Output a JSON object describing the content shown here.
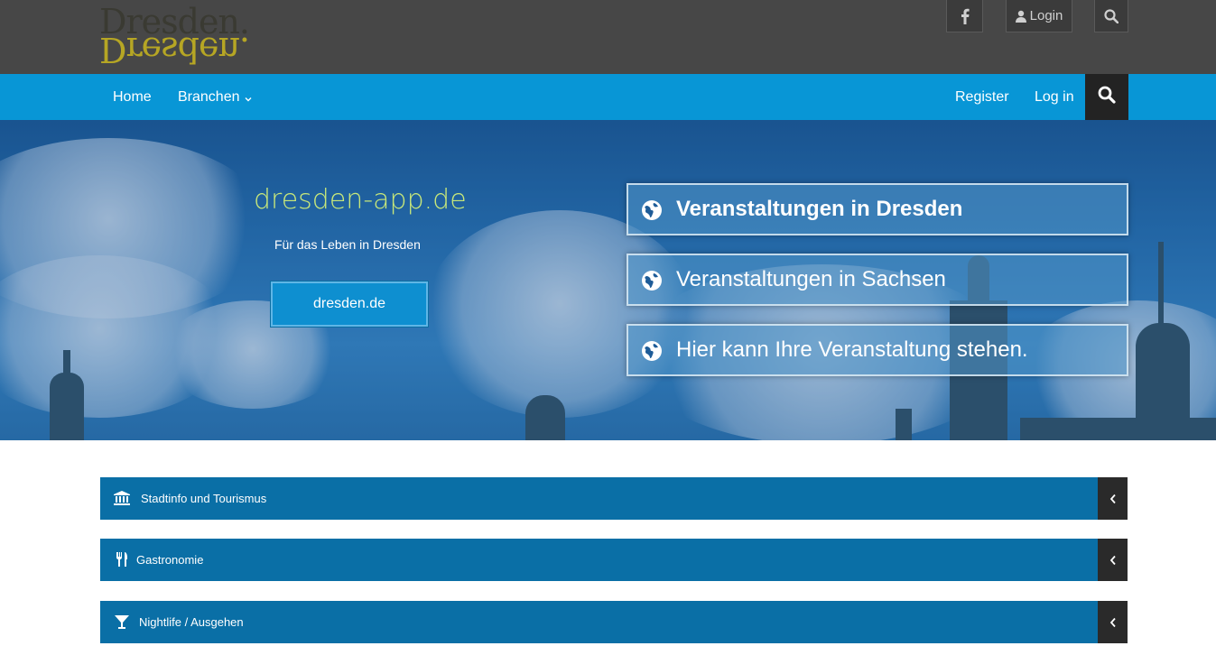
{
  "header": {
    "logo_text": "Dresden.",
    "login_label": "Login",
    "icons": [
      "facebook-icon",
      "user-icon",
      "search-icon"
    ]
  },
  "nav": {
    "home": "Home",
    "branchen": "Branchen",
    "register": "Register",
    "login": "Log in"
  },
  "hero": {
    "title": "dresden-app.de",
    "subtitle": "Für das Leben in Dresden",
    "button": "dresden.de",
    "events": [
      {
        "label": "Veranstaltungen in Dresden",
        "icon": "globe-icon"
      },
      {
        "label": "Veranstaltungen in Sachsen",
        "icon": "globe-icon"
      },
      {
        "label": "Hier kann Ihre Veranstaltung stehen.",
        "icon": "globe-icon"
      }
    ]
  },
  "categories": [
    {
      "label": "Stadtinfo und Tourismus",
      "icon": "institution-icon"
    },
    {
      "label": "Gastronomie",
      "icon": "cutlery-icon"
    },
    {
      "label": "Nightlife / Ausgehen",
      "icon": "cocktail-icon"
    }
  ],
  "colors": {
    "topbar": "#474747",
    "nav": "#0896d6",
    "accordion": "#0a6fa6",
    "title_accent": "#c8e87a"
  }
}
